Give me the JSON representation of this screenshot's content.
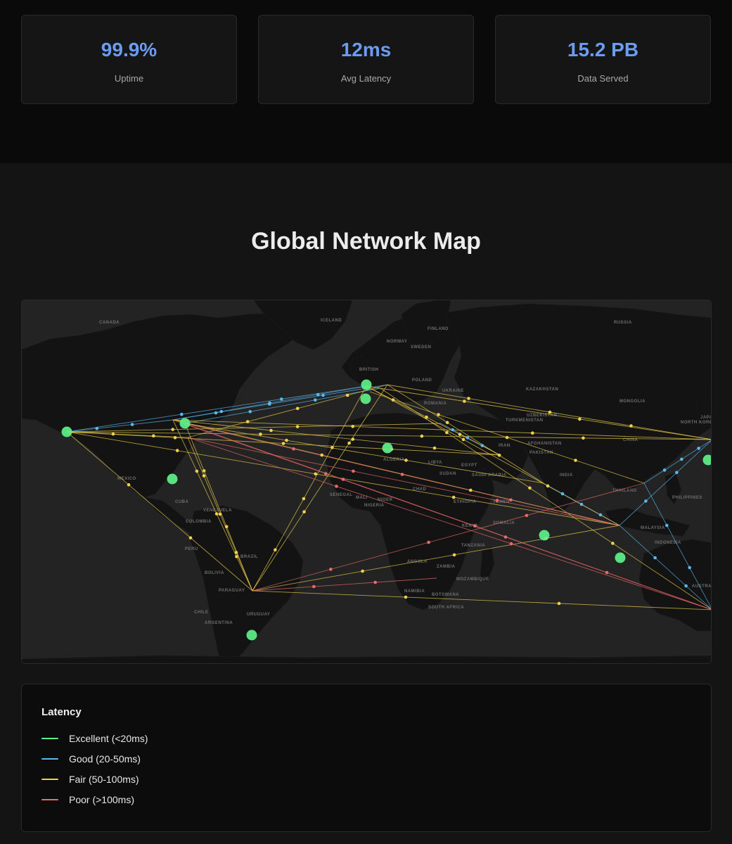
{
  "stats": [
    {
      "value": "99.9%",
      "label": "Uptime"
    },
    {
      "value": "12ms",
      "label": "Avg Latency"
    },
    {
      "value": "15.2 PB",
      "label": "Data Served"
    }
  ],
  "map_section": {
    "title": "Global Network Map"
  },
  "map": {
    "country_labels": [
      "CANADA",
      "ICELAND",
      "FINLAND",
      "NORWAY",
      "SWEDEN",
      "RUSSIA",
      "BRITISH",
      "POLAND",
      "UKRAINE",
      "KAZAKHSTAN",
      "MONGOLIA",
      "ROMANIA",
      "UZBEKISTAN",
      "TURKMENISTAN",
      "AFGHANISTAN",
      "IRAN",
      "PAKISTAN",
      "CHINA",
      "NORTH KOREA",
      "ALGERIA",
      "LIBYA",
      "EGYPT",
      "SAUDI ARABIA",
      "INDIA",
      "THAILAND",
      "PHILIPPINES",
      "MALAYSIA",
      "SENEGAL",
      "MALI",
      "NIGER",
      "NIGERIA",
      "ETHIOPIA",
      "KENYA",
      "TANZANIA",
      "ANGOLA",
      "ZAMBIA",
      "MOZAMBIQUE",
      "NAMIBIA",
      "SOUTH AFRICA",
      "AUSTRALIA",
      "INDONESIA",
      "MEXICO",
      "VENEZUELA",
      "COLOMBIA",
      "PERU",
      "BRAZIL",
      "BOLIVIA",
      "PARAGUAY",
      "CHILE",
      "ARGENTINA",
      "URUGUAY",
      "CUBA",
      "YEMEN",
      "SOMALIA",
      "BOTSWANA",
      "SUDAN",
      "CHAD",
      "JAPAN"
    ],
    "colors": {
      "excellent": "#5ef28a",
      "good": "#5ab8ec",
      "fair": "#f0d24a",
      "poor": "#ee6a6a"
    }
  },
  "legend": {
    "title": "Latency",
    "items": [
      {
        "label": "Excellent (<20ms)",
        "color": "#5ef28a"
      },
      {
        "label": "Good (20-50ms)",
        "color": "#5ab8ec"
      },
      {
        "label": "Fair (50-100ms)",
        "color": "#f0d24a"
      },
      {
        "label": "Poor (>100ms)",
        "color": "#ee6a6a"
      }
    ]
  }
}
